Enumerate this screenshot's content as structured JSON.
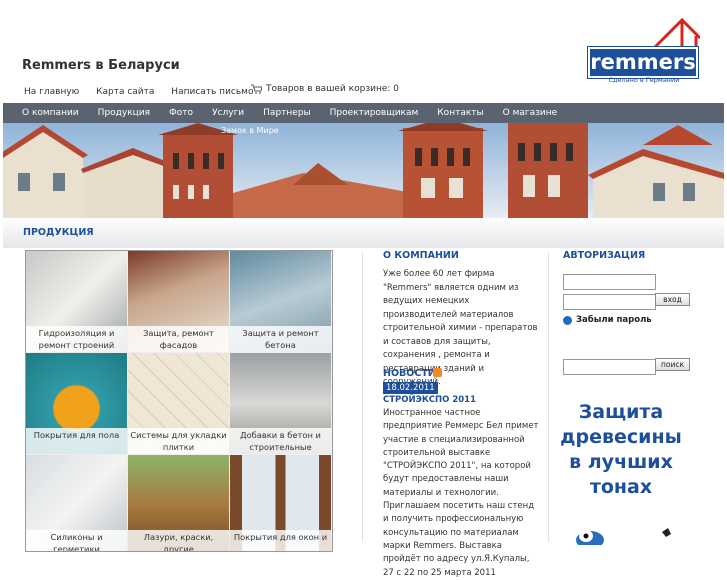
{
  "header": {
    "site_title": "Remmers в Беларуси",
    "links": [
      "На главную",
      "Карта сайта",
      "Написать письмо"
    ],
    "cart_text": "Товаров в вашей корзине: 0"
  },
  "logo": {
    "brand": "remmers",
    "tagline": "Сделано в Германии"
  },
  "nav": [
    "О компании",
    "Продукция",
    "Фото",
    "Услуги",
    "Партнеры",
    "Проектировщикам",
    "Контакты",
    "О магазине"
  ],
  "banner": {
    "caption": "Замок в Мире"
  },
  "products": {
    "heading": "ПРОДУКЦИЯ",
    "items": [
      "Гидроизоляция и ремонт строений",
      "Защита, ремонт фасадов",
      "Защита и ремонт бетона",
      "Покрытия для пола",
      "Системы для укладки плитки",
      "Добавки в бетон и строительные растворы",
      "Силиконы и герметики",
      "Лазури, краски, другие",
      "Покрытия для окон и"
    ]
  },
  "about": {
    "heading": "О КОМПАНИИ",
    "text": "Уже более 60 лет фирма \"Remmers\" является одним из ведущих немецких производителей материалов строительной химии - препаратов и составов для защиты, сохранения , ремонта и реставрации зданий и сооружений."
  },
  "news": {
    "heading": "НОВОСТИ",
    "date": "18.02.2011",
    "title": "СТРОЙЭКСПО 2011",
    "text": "Иностранное частное предприятие Реммерс Бел примет участие в специализированной строительной выставке \"СТРОЙЭКСПО 2011\", на которой будут предоставлены наши материалы и технологии. Приглашаем посетить наш стенд и получить профессиональную консультацию по материалам марки Remmers. Выставка пройдёт по адресу ул.Я.Купалы, 27 с 22 по 25 марта 2011"
  },
  "auth": {
    "heading": "АВТОРИЗАЦИЯ",
    "login_button": "вход",
    "forgot": "Забыли пароль",
    "search_button": "поиск"
  },
  "ad": {
    "text": "Защита древесины в лучших тонах"
  },
  "colors": {
    "brand_blue": "#1d4f9b",
    "nav_bg": "#5a6470",
    "rss_orange": "#f08a24"
  }
}
